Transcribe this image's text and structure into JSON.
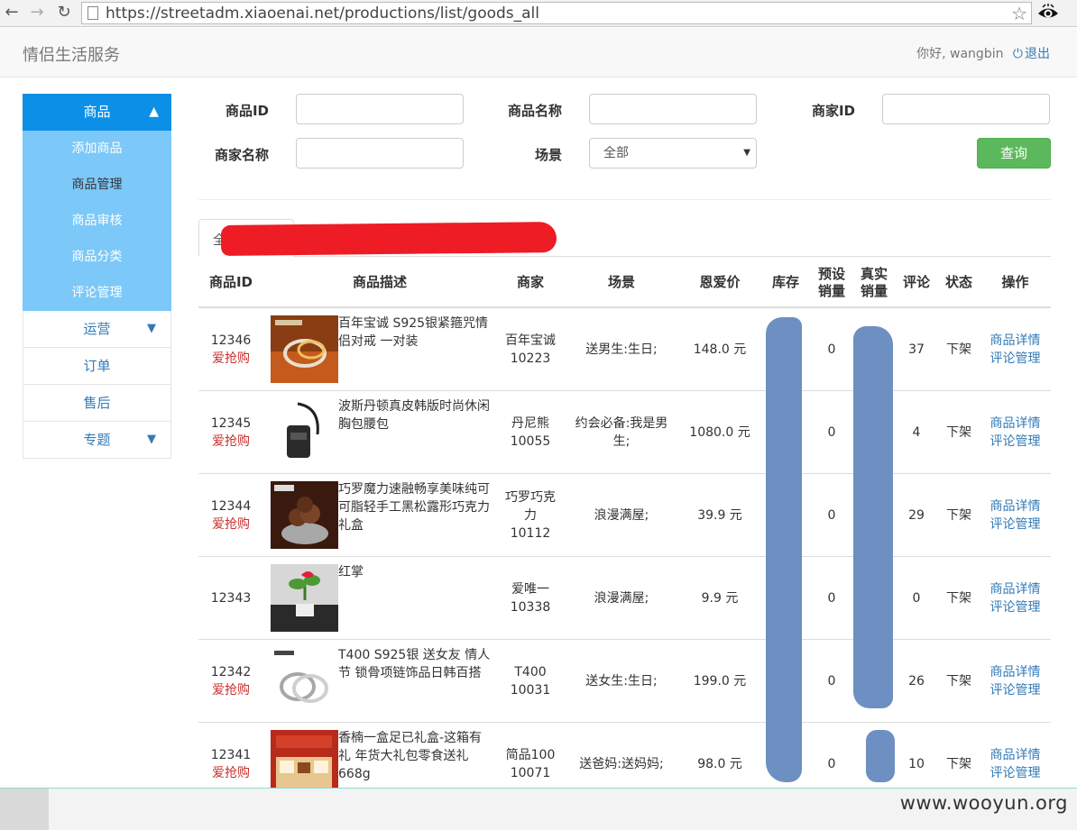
{
  "browser": {
    "url": "https://streetadm.xiaoenai.net/productions/list/goods_all"
  },
  "header": {
    "brand": "情侣生活服务",
    "greeting": "你好, wangbin",
    "logout": "退出"
  },
  "sidebar": {
    "head": "商品",
    "sub_items": [
      "添加商品",
      "商品管理",
      "商品审核",
      "商品分类",
      "评论管理"
    ],
    "active_sub": "商品管理",
    "items": [
      "运营",
      "订单",
      "售后",
      "专题"
    ]
  },
  "search": {
    "goods_id_label": "商品ID",
    "goods_name_label": "商品名称",
    "merchant_id_label": "商家ID",
    "merchant_name_label": "商家名称",
    "scene_label": "场景",
    "scene_value": "全部",
    "query_button": "查询"
  },
  "tabs": {
    "first": "全部"
  },
  "table": {
    "headers": {
      "id": "商品ID",
      "desc": "商品描述",
      "merchant": "商家",
      "scene": "场景",
      "price": "恩爱价",
      "stock": "库存",
      "presale": "预设销量",
      "realsale": "真实销量",
      "comments": "评论",
      "status": "状态",
      "ops": "操作"
    },
    "rows": [
      {
        "id": "12346",
        "badge": "爱抢购",
        "desc": "百年宝诚 S925银紧箍咒情侣对戒 一对装",
        "merchant": "百年宝诚",
        "merchant_id": "10223",
        "scene": "送男生:生日;",
        "price": "148.0 元",
        "presale": "0",
        "comments": "37",
        "status": "下架",
        "op1": "商品详情",
        "op2": "评论管理"
      },
      {
        "id": "12345",
        "badge": "爱抢购",
        "desc": "波斯丹顿真皮韩版时尚休闲胸包腰包",
        "merchant": "丹尼熊",
        "merchant_id": "10055",
        "scene": "约会必备:我是男生;",
        "price": "1080.0 元",
        "presale": "0",
        "comments": "4",
        "status": "下架",
        "op1": "商品详情",
        "op2": "评论管理"
      },
      {
        "id": "12344",
        "badge": "爱抢购",
        "desc": "巧罗魔力速融畅享美味纯可可脂轻手工黑松露形巧克力礼盒",
        "merchant": "巧罗巧克力",
        "merchant_id": "10112",
        "scene": "浪漫满屋;",
        "price": "39.9 元",
        "presale": "0",
        "comments": "29",
        "status": "下架",
        "op1": "商品详情",
        "op2": "评论管理"
      },
      {
        "id": "12343",
        "badge": "",
        "desc": "红掌",
        "merchant": "爱唯一",
        "merchant_id": "10338",
        "scene": "浪漫满屋;",
        "price": "9.9 元",
        "presale": "0",
        "comments": "0",
        "status": "下架",
        "op1": "商品详情",
        "op2": "评论管理"
      },
      {
        "id": "12342",
        "badge": "爱抢购",
        "desc": "T400 S925银 送女友 情人节 锁骨项链饰品日韩百搭",
        "merchant": "T400",
        "merchant_id": "10031",
        "scene": "送女生:生日;",
        "price": "199.0 元",
        "presale": "0",
        "comments": "26",
        "status": "下架",
        "op1": "商品详情",
        "op2": "评论管理"
      },
      {
        "id": "12341",
        "badge": "爱抢购",
        "desc": "香楠一盒足已礼盒-这箱有礼 年货大礼包零食送礼 668g",
        "merchant": "简品100",
        "merchant_id": "10071",
        "scene": "送爸妈:送妈妈;",
        "price": "98.0 元",
        "presale": "0",
        "comments": "10",
        "status": "下架",
        "op1": "商品详情",
        "op2": "评论管理"
      }
    ]
  },
  "watermark": "www.wooyun.org",
  "colors": {
    "sidebar_active": "#0c8fe6",
    "sidebar_sub": "#7cc8f8",
    "link": "#337ab7",
    "sale": "#c9302c",
    "query_button": "#5cb85c",
    "redaction_red": "#ee1c25",
    "redaction_blue": "#6e8fc1"
  }
}
